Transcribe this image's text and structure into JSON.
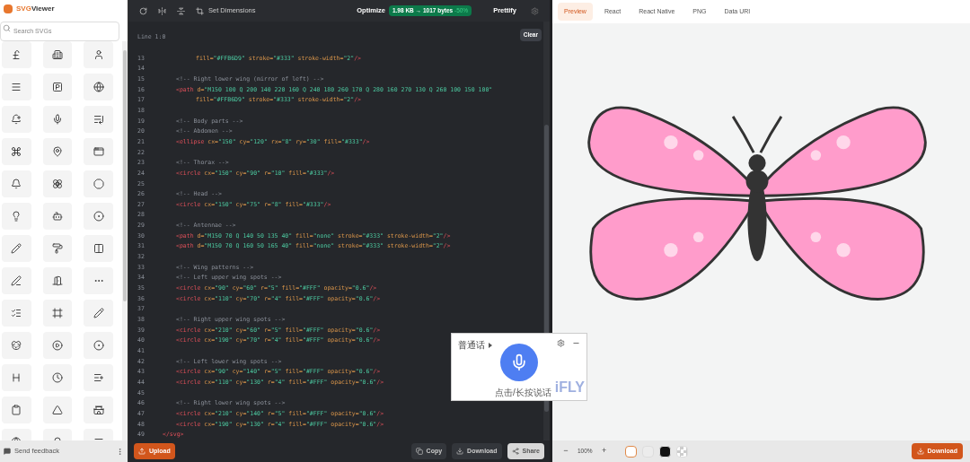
{
  "sidebar": {
    "logo_accent": "SVG",
    "logo_rest": "Viewer",
    "search": {
      "placeholder": "Search SVGs"
    },
    "footer": {
      "feedback": "Send feedback"
    }
  },
  "toolbar": {
    "set_dimensions": "Set Dimensions",
    "optimize": "Optimize",
    "size_from": "1.98 KB",
    "arrow": "→",
    "size_to": "1017 bytes",
    "saving": "-50%",
    "prettify": "Prettify"
  },
  "editor": {
    "position": "Line 1:0",
    "clear": "Clear",
    "lines": [
      {
        "n": "13",
        "kind": "continuation",
        "text": "fill=\"#FFB6D9\" stroke=\"#333\" stroke-width=\"2\"/>"
      },
      {
        "n": "14",
        "kind": "blank"
      },
      {
        "n": "15",
        "kind": "comment",
        "text": "<!-- Right lower wing (mirror of left) -->"
      },
      {
        "n": "16",
        "kind": "code",
        "text": "<path d=\"M150 100 Q 200 140 220 160 Q 240 180 260 170 Q 280 160 270 130 Q 260 100 150 100\""
      },
      {
        "n": "17",
        "kind": "continuation",
        "text": "fill=\"#FFB6D9\" stroke=\"#333\" stroke-width=\"2\"/>"
      },
      {
        "n": "18",
        "kind": "blank"
      },
      {
        "n": "19",
        "kind": "comment",
        "text": "<!-- Body parts -->"
      },
      {
        "n": "20",
        "kind": "comment",
        "text": "<!-- Abdomen -->"
      },
      {
        "n": "21",
        "kind": "code",
        "text": "<ellipse cx=\"150\" cy=\"120\" rx=\"8\" ry=\"30\" fill=\"#333\"/>"
      },
      {
        "n": "22",
        "kind": "blank"
      },
      {
        "n": "23",
        "kind": "comment",
        "text": "<!-- Thorax -->"
      },
      {
        "n": "24",
        "kind": "code",
        "text": "<circle cx=\"150\" cy=\"90\" r=\"10\" fill=\"#333\"/>"
      },
      {
        "n": "25",
        "kind": "blank"
      },
      {
        "n": "26",
        "kind": "comment",
        "text": "<!-- Head -->"
      },
      {
        "n": "27",
        "kind": "code",
        "text": "<circle cx=\"150\" cy=\"75\" r=\"8\" fill=\"#333\"/>"
      },
      {
        "n": "28",
        "kind": "blank"
      },
      {
        "n": "29",
        "kind": "comment",
        "text": "<!-- Antennae -->"
      },
      {
        "n": "30",
        "kind": "code",
        "text": "<path d=\"M150 70 Q 140 50 135 40\" fill=\"none\" stroke=\"#333\" stroke-width=\"2\"/>"
      },
      {
        "n": "31",
        "kind": "code",
        "text": "<path d=\"M150 70 Q 160 50 165 40\" fill=\"none\" stroke=\"#333\" stroke-width=\"2\"/>"
      },
      {
        "n": "32",
        "kind": "blank"
      },
      {
        "n": "33",
        "kind": "comment",
        "text": "<!-- Wing patterns -->"
      },
      {
        "n": "34",
        "kind": "comment",
        "text": "<!-- Left upper wing spots -->"
      },
      {
        "n": "35",
        "kind": "code",
        "text": "<circle cx=\"90\" cy=\"60\" r=\"5\" fill=\"#FFF\" opacity=\"0.6\"/>"
      },
      {
        "n": "36",
        "kind": "code",
        "text": "<circle cx=\"110\" cy=\"70\" r=\"4\" fill=\"#FFF\" opacity=\"0.6\"/>"
      },
      {
        "n": "37",
        "kind": "blank"
      },
      {
        "n": "38",
        "kind": "comment",
        "text": "<!-- Right upper wing spots -->"
      },
      {
        "n": "39",
        "kind": "code",
        "text": "<circle cx=\"210\" cy=\"60\" r=\"5\" fill=\"#FFF\" opacity=\"0.6\"/>"
      },
      {
        "n": "40",
        "kind": "code",
        "text": "<circle cx=\"190\" cy=\"70\" r=\"4\" fill=\"#FFF\" opacity=\"0.6\"/>"
      },
      {
        "n": "41",
        "kind": "blank"
      },
      {
        "n": "42",
        "kind": "comment",
        "text": "<!-- Left lower wing spots -->"
      },
      {
        "n": "43",
        "kind": "code",
        "text": "<circle cx=\"90\" cy=\"140\" r=\"5\" fill=\"#FFF\" opacity=\"0.6\"/>"
      },
      {
        "n": "44",
        "kind": "code",
        "text": "<circle cx=\"110\" cy=\"130\" r=\"4\" fill=\"#FFF\" opacity=\"0.6\"/>"
      },
      {
        "n": "45",
        "kind": "blank"
      },
      {
        "n": "46",
        "kind": "comment",
        "text": "<!-- Right lower wing spots -->"
      },
      {
        "n": "47",
        "kind": "code",
        "text": "<circle cx=\"210\" cy=\"140\" r=\"5\" fill=\"#FFF\" opacity=\"0.6\"/>"
      },
      {
        "n": "48",
        "kind": "code",
        "text": "<circle cx=\"190\" cy=\"130\" r=\"4\" fill=\"#FFF\" opacity=\"0.6\"/>"
      },
      {
        "n": "49",
        "kind": "close",
        "text": "</svg>"
      }
    ]
  },
  "editor_footer": {
    "upload": "Upload",
    "copy": "Copy",
    "download": "Download",
    "share": "Share"
  },
  "voice_widget": {
    "language": "普通话",
    "hint": "点击/长按说话",
    "brand": "iFLY"
  },
  "preview": {
    "tabs": [
      {
        "label": "Preview",
        "selected": true
      },
      {
        "label": "React",
        "selected": false
      },
      {
        "label": "React Native",
        "selected": false
      },
      {
        "label": "PNG",
        "selected": false
      },
      {
        "label": "Data URI",
        "selected": false
      }
    ],
    "zoom": {
      "minus": "−",
      "value": "100%",
      "plus": "+"
    },
    "backgrounds": [
      {
        "color": "#ffffff",
        "selected": true
      },
      {
        "color": "#ececec",
        "selected": false
      },
      {
        "color": "#111111",
        "selected": false
      },
      {
        "kind": "checker",
        "selected": false
      }
    ],
    "download": "Download"
  }
}
